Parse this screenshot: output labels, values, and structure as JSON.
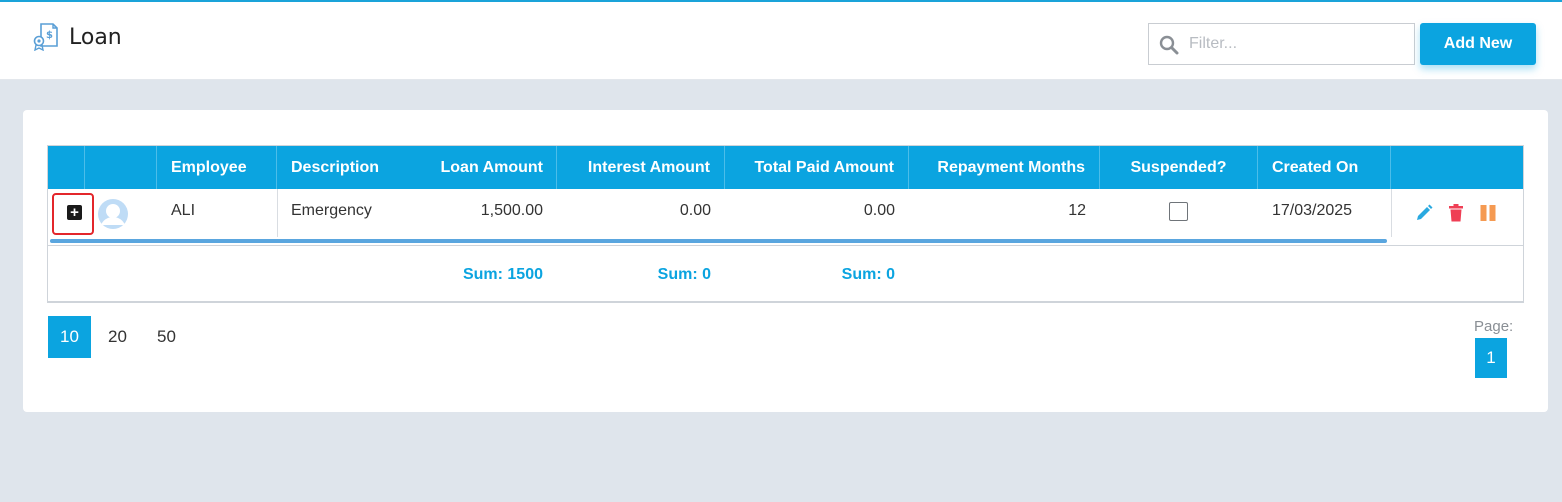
{
  "header": {
    "title": "Loan",
    "filter_placeholder": "Filter...",
    "add_new_label": "Add New"
  },
  "grid": {
    "columns": [
      "",
      "",
      "Employee",
      "Description",
      "Loan Amount",
      "Interest Amount",
      "Total Paid Amount",
      "Repayment Months",
      "Suspended?",
      "Created On",
      ""
    ],
    "rows": [
      {
        "employee": "ALI",
        "description": "Emergency",
        "loan_amount": "1,500.00",
        "interest_amount": "0.00",
        "total_paid_amount": "0.00",
        "repayment_months": "12",
        "suspended": false,
        "created_on": "17/03/2025"
      }
    ],
    "totals": {
      "loan_amount": "Sum: 1500",
      "interest_amount": "Sum: 0",
      "total_paid_amount": "Sum: 0"
    }
  },
  "pager": {
    "page_sizes": [
      "10",
      "20",
      "50"
    ],
    "active_page_size": "10",
    "page_label": "Page:",
    "current_page": "1"
  },
  "colors": {
    "accent": "#0ba4e0",
    "edit_icon": "#29a9e0",
    "delete_icon": "#ef3f55",
    "suspend_icon": "#f59a52"
  },
  "icons": {
    "page": "loan-document-icon",
    "search": "search-icon",
    "expand": "plus-square-icon",
    "avatar": "user-avatar-icon",
    "edit": "pencil-icon",
    "delete": "trash-icon",
    "suspend": "pause-icon"
  }
}
